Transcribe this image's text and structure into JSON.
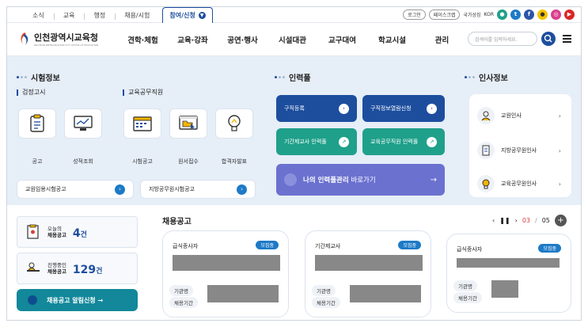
{
  "topbar": {
    "tabs": [
      "소식",
      "교육",
      "행정",
      "채용/시험"
    ],
    "active_tab": "참여/신청",
    "login": "로그인",
    "sitemap": "페이스크랩",
    "lang": "국가상징",
    "lang_code": "KOR"
  },
  "nav": {
    "logo_title": "인천광역시교육청",
    "logo_sub": "INCHEON METROPOLITAN CITY OFFICE OF EDUCATION",
    "menu": [
      "견학·체험",
      "교육·강좌",
      "공연·행사",
      "시설대관",
      "교구대여",
      "학교시설",
      "관리"
    ],
    "search_placeholder": "검색어를 입력하세요."
  },
  "exam": {
    "title": "시험정보",
    "sub1": "검정고시",
    "sub2": "교육공무직원",
    "cards": [
      "공고",
      "성적조회",
      "시험공고",
      "원서접수",
      "합격자발표"
    ],
    "btn1": "교원임용시험공고",
    "btn2": "지방공무원시험공고"
  },
  "talent": {
    "title": "인력풀",
    "b1": "구직등록",
    "b2": "구직정보열람신청",
    "b3": "기간제교사 인력풀",
    "b4": "교육공무직원 인력풀",
    "my_bold": "나의 인력풀관리",
    "my_rest": " 바로가기"
  },
  "hr": {
    "title": "인사정보",
    "items": [
      "교원인사",
      "지방공무원인사",
      "교육공무원인사"
    ]
  },
  "stats": {
    "today_l1": "오늘의",
    "today_l2": "채용공고",
    "today_num": "4",
    "today_unit": "건",
    "ongoing_l1": "진행중인",
    "ongoing_l2": "채용공고",
    "ongoing_num": "129",
    "ongoing_unit": "건",
    "alert": "채용공고 알림신청 →"
  },
  "jobs": {
    "title": "채용공고",
    "page": "03",
    "total": "05",
    "cards": [
      {
        "category": "급식종사자",
        "badge": "모집중"
      },
      {
        "category": "기간제교사",
        "badge": "모집중"
      },
      {
        "category": "급식종사자",
        "badge": "모집중"
      }
    ],
    "label_org": "기관명",
    "label_period": "채용기간"
  },
  "colors": {
    "primary": "#1d4e9e",
    "teal": "#12889a",
    "green": "#1fa08a",
    "purple": "#6b71cf"
  }
}
